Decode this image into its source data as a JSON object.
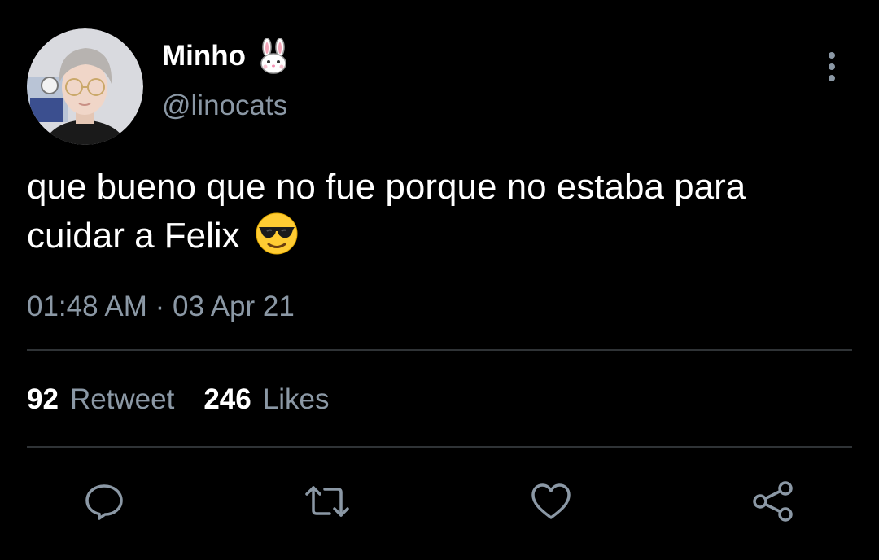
{
  "tweet": {
    "display_name": "Minho",
    "name_emoji": "rabbit-face-emoji",
    "handle": "@linocats",
    "text": "que bueno que no fue porque no estaba para cuidar a Felix",
    "text_emoji": "smiling-face-with-sunglasses-emoji",
    "timestamp": "01:48 AM · 03 Apr 21",
    "retweet_count": "92",
    "retweet_label": "Retweet",
    "likes_count": "246",
    "likes_label": "Likes"
  },
  "actions": [
    {
      "icon": "reply-icon"
    },
    {
      "icon": "retweet-icon"
    },
    {
      "icon": "like-icon"
    },
    {
      "icon": "share-icon"
    }
  ],
  "colors": {
    "background": "#000000",
    "primary_text": "#ffffff",
    "secondary_text": "#8b98a5",
    "divider": "#2f3336"
  }
}
